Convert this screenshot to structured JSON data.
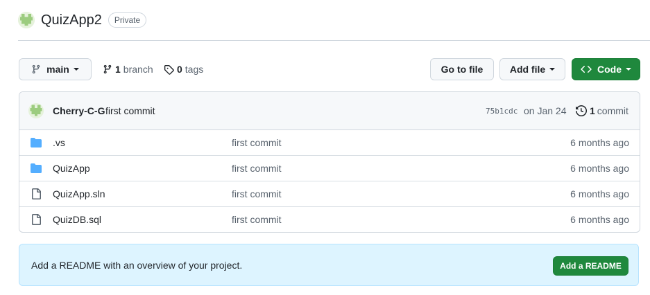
{
  "repo": {
    "name": "QuizApp2",
    "visibility": "Private",
    "avatar_icon": "identicon-avatar"
  },
  "toolbar": {
    "branch_name": "main",
    "branch_count": "1",
    "branch_label": "branch",
    "tag_count": "0",
    "tag_label": "tags",
    "go_to_file_label": "Go to file",
    "add_file_label": "Add file",
    "code_label": "Code"
  },
  "latest_commit": {
    "author": "Cherry-C-G",
    "message": "first commit",
    "sha": "75b1cdc",
    "date": "on Jan 24",
    "count": "1",
    "count_label": "commit"
  },
  "files": [
    {
      "name": ".vs",
      "type": "folder",
      "icon": "folder-icon",
      "commit": "first commit",
      "age": "6 months ago"
    },
    {
      "name": "QuizApp",
      "type": "folder",
      "icon": "folder-icon",
      "commit": "first commit",
      "age": "6 months ago"
    },
    {
      "name": "QuizApp.sln",
      "type": "file",
      "icon": "file-icon",
      "commit": "first commit",
      "age": "6 months ago"
    },
    {
      "name": "QuizDB.sql",
      "type": "file",
      "icon": "file-icon",
      "commit": "first commit",
      "age": "6 months ago"
    }
  ],
  "readme_banner": {
    "text": "Add a README with an overview of your project.",
    "button_label": "Add a README"
  },
  "colors": {
    "primary_green": "#1f883d",
    "folder_blue": "#54aeff",
    "banner_bg": "#ddf4ff",
    "avatar_green": "#a7d48a"
  }
}
